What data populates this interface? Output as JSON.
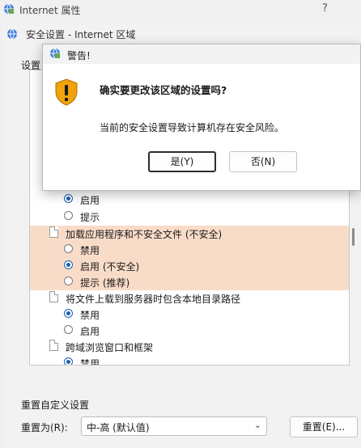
{
  "outer_window": {
    "title": "Internet 属性",
    "help_label": "?"
  },
  "inner_window": {
    "title": "安全设置 - Internet 区域",
    "settings_label": "设置"
  },
  "settings_list": {
    "rows": [
      {
        "kind": "radio",
        "label": "启用",
        "checked": true,
        "highlight": false
      },
      {
        "kind": "radio",
        "label": "提示",
        "checked": false,
        "highlight": false
      },
      {
        "kind": "category",
        "label": "加载应用程序和不安全文件 (不安全)",
        "highlight": true
      },
      {
        "kind": "radio",
        "label": "禁用",
        "checked": false,
        "highlight": true
      },
      {
        "kind": "radio",
        "label": "启用 (不安全)",
        "checked": true,
        "highlight": true
      },
      {
        "kind": "radio",
        "label": "提示 (推荐)",
        "checked": false,
        "highlight": true
      },
      {
        "kind": "category",
        "label": "将文件上载到服务器时包含本地目录路径",
        "highlight": false
      },
      {
        "kind": "radio",
        "label": "禁用",
        "checked": true,
        "highlight": false
      },
      {
        "kind": "radio",
        "label": "启用",
        "checked": false,
        "highlight": false
      },
      {
        "kind": "category",
        "label": "跨域浏览窗口和框架",
        "highlight": false
      },
      {
        "kind": "radio",
        "label": "禁用",
        "checked": true,
        "highlight": false
      }
    ]
  },
  "reset": {
    "group_label": "重置自定义设置",
    "reset_to_label": "重置为(R):",
    "selected_level": "中-高 (默认值)",
    "reset_button": "重置(E)..."
  },
  "warning_dialog": {
    "title": "警告!",
    "question": "确实要更改该区域的设置吗?",
    "detail": "当前的安全设置导致计算机存在安全风险。",
    "yes_button": "是(Y)",
    "no_button": "否(N)"
  },
  "colors": {
    "highlight_row": "#f9dcc8",
    "radio_accent": "#1a5fb4",
    "warning_shield": "#f0a30a"
  }
}
